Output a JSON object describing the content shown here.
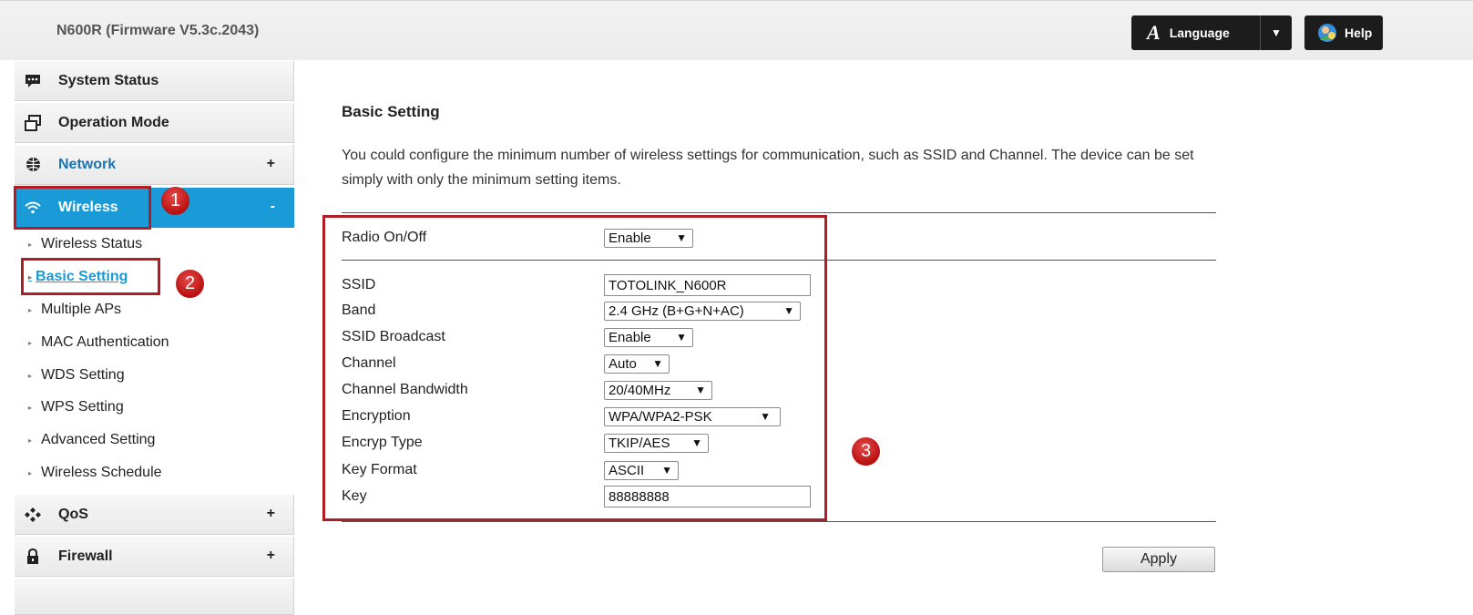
{
  "header": {
    "title": "N600R (Firmware V5.3c.2043)",
    "language_label": "Language",
    "language_icon": "A",
    "help_label": "Help"
  },
  "sidebar": {
    "items": [
      {
        "label": "System Status",
        "icon": "chat-icon"
      },
      {
        "label": "Operation Mode",
        "icon": "windows-icon"
      },
      {
        "label": "Network",
        "icon": "globe-icon",
        "sign": "+"
      },
      {
        "label": "Wireless",
        "icon": "wifi-icon",
        "sign": "-"
      },
      {
        "label": "QoS",
        "icon": "diamonds-icon",
        "sign": "+"
      },
      {
        "label": "Firewall",
        "icon": "lock-icon",
        "sign": "+"
      }
    ],
    "wireless_sub": [
      "Wireless Status",
      "Basic Setting",
      "Multiple APs",
      "MAC Authentication",
      "WDS Setting",
      "WPS Setting",
      "Advanced Setting",
      "Wireless Schedule"
    ]
  },
  "annotations": [
    "1",
    "2",
    "3"
  ],
  "main": {
    "title": "Basic Setting",
    "description": "You could configure the minimum number of wireless settings for communication, such as SSID and Channel. The device can be set simply with only the minimum setting items.",
    "radio": {
      "label": "Radio On/Off",
      "value": "Enable"
    },
    "fields": {
      "ssid": {
        "label": "SSID",
        "value": "TOTOLINK_N600R"
      },
      "band": {
        "label": "Band",
        "value": "2.4 GHz (B+G+N+AC)"
      },
      "broadcast": {
        "label": "SSID Broadcast",
        "value": "Enable"
      },
      "channel": {
        "label": "Channel",
        "value": "Auto"
      },
      "bandwidth": {
        "label": "Channel Bandwidth",
        "value": "20/40MHz"
      },
      "encryption": {
        "label": "Encryption",
        "value": "WPA/WPA2-PSK"
      },
      "encryp_type": {
        "label": "Encryp Type",
        "value": "TKIP/AES"
      },
      "key_format": {
        "label": "Key Format",
        "value": "ASCII"
      },
      "key": {
        "label": "Key",
        "value": "88888888"
      }
    },
    "apply_label": "Apply",
    "dropdown_arrow": "▼"
  },
  "colors": {
    "accent": "#1a9ad6",
    "annotation_red": "#b21c24",
    "header_button": "#1c1c1c"
  }
}
